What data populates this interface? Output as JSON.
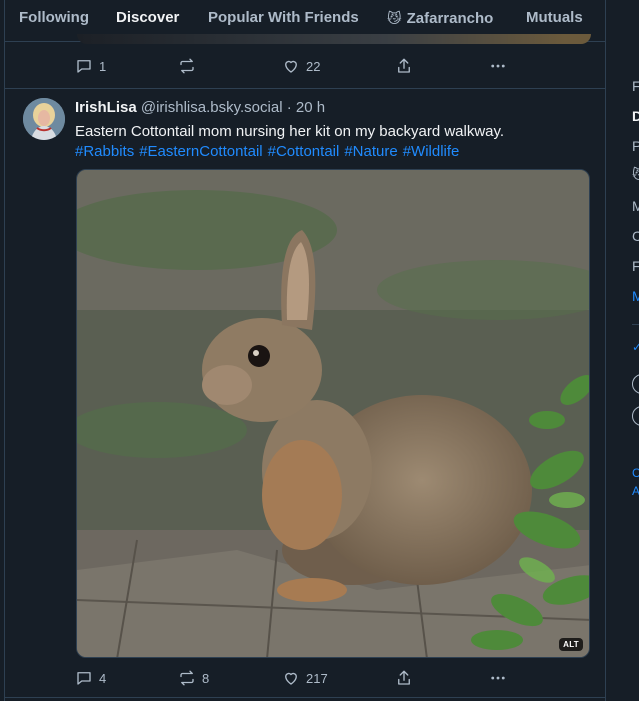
{
  "tabs": [
    {
      "label": "Following",
      "active": false
    },
    {
      "label": "Discover",
      "active": true
    },
    {
      "label": "Popular With Friends",
      "active": false
    },
    {
      "label": "Zafarrancho",
      "emoji": "😼",
      "active": false
    },
    {
      "label": "Mutuals",
      "active": false
    }
  ],
  "previous_post": {
    "reply_count": "1",
    "repost_count": "",
    "like_count": "22"
  },
  "post": {
    "author": "IrishLisa",
    "handle": "@irishlisa.bsky.social",
    "separator": "·",
    "time": "20 h",
    "text": "Eastern Cottontail mom nursing her kit on my backyard walkway.",
    "hashtags": [
      "#Rabbits",
      "#EasternCottontail",
      "#Cottontail",
      "#Nature",
      "#Wildlife"
    ],
    "image_alt_badge": "ALT",
    "reply_count": "4",
    "repost_count": "8",
    "like_count": "217"
  },
  "right_column": {
    "items": [
      "F",
      "D",
      "P",
      "😼",
      "M",
      "C",
      "F",
      "M",
      "C",
      "A"
    ]
  },
  "colors": {
    "background": "#161e27",
    "border": "#2e4052",
    "accent": "#0085ff",
    "link": "#208bfe",
    "muted_text": "#aebbc9"
  }
}
